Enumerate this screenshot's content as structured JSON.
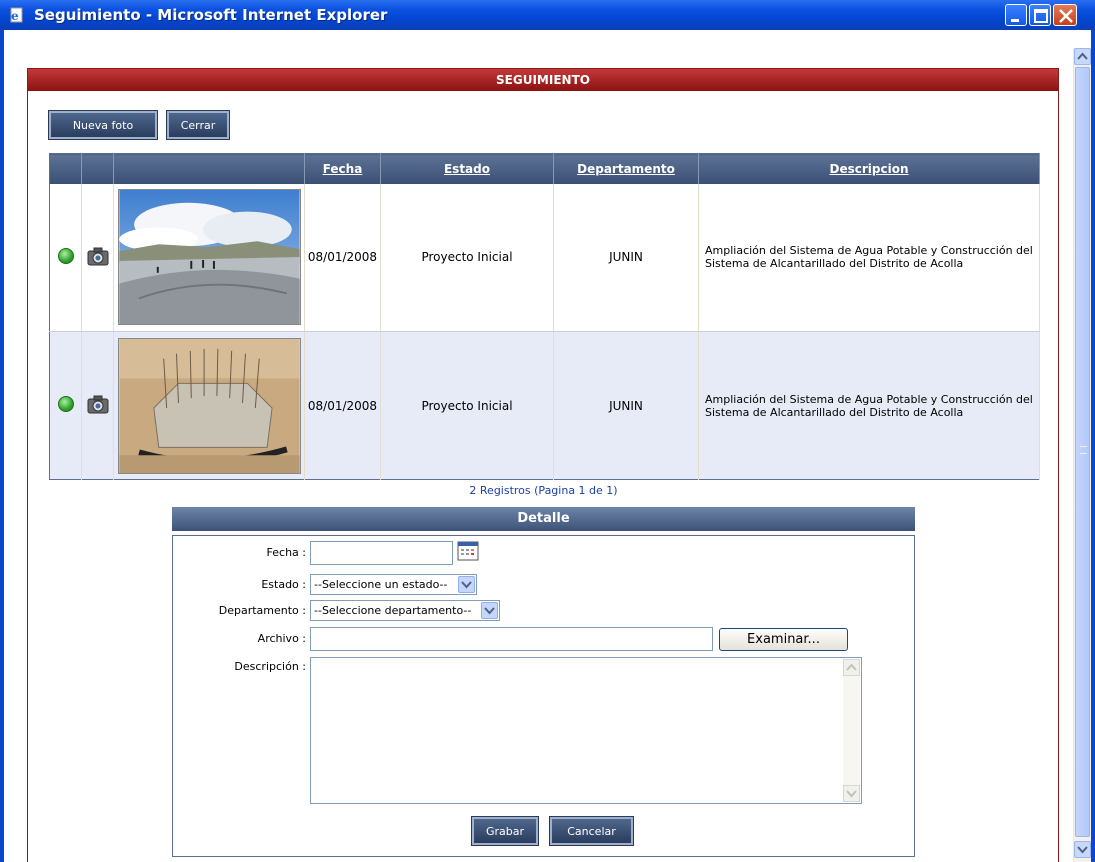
{
  "window": {
    "title": "Seguimiento - Microsoft Internet Explorer"
  },
  "panel": {
    "header": "SEGUIMIENTO",
    "buttons": {
      "new_photo": "Nueva foto",
      "close": "Cerrar"
    }
  },
  "grid": {
    "columns": [
      "",
      "",
      "",
      "Fecha",
      "Estado",
      "Departamento",
      "Descripcion"
    ],
    "rows": [
      {
        "status_icon": "green-dot-icon",
        "camera_icon": "camera-icon",
        "image": "lined-pond-under-cloudy-sky-photo",
        "fecha": "08/01/2008",
        "estado": "Proyecto Inicial",
        "departamento": "JUNIN",
        "descripcion": "Ampliación del Sistema de Agua Potable y Construcción del Sistema de Alcantarillado del Distrito de Acolla"
      },
      {
        "status_icon": "green-dot-icon",
        "camera_icon": "camera-icon",
        "image": "concrete-rebar-construction-photo",
        "fecha": "08/01/2008",
        "estado": "Proyecto Inicial",
        "departamento": "JUNIN",
        "descripcion": "Ampliación del Sistema de Agua Potable y Construcción del Sistema de Alcantarillado del Distrito de Acolla"
      }
    ],
    "pager": "2 Registros (Pagina 1 de 1)"
  },
  "detail": {
    "title": "Detalle",
    "labels": {
      "fecha": "Fecha :",
      "estado": "Estado :",
      "departamento": "Departamento :",
      "archivo": "Archivo :",
      "descripcion": "Descripción :"
    },
    "fields": {
      "fecha_value": "",
      "estado_selected": "--Seleccione un estado--",
      "departamento_selected": "--Seleccione departamento--",
      "archivo_value": "",
      "descripcion_value": ""
    },
    "buttons": {
      "browse": "Examinar...",
      "save": "Grabar",
      "cancel": "Cancelar"
    }
  },
  "colors": {
    "header_red": "#8b1111",
    "grid_header_blue": "#3a4f73",
    "xp_blue": "#0447d3"
  }
}
